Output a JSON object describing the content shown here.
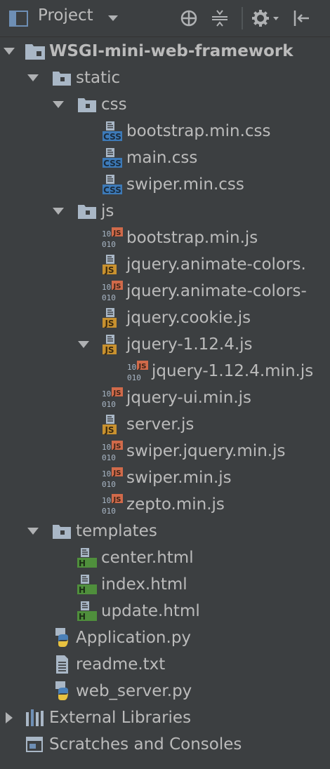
{
  "toolbar": {
    "title": "Project",
    "icons": [
      "project-view-icon",
      "caret-down-icon",
      "locate-icon",
      "collapse-all-icon",
      "gear-icon",
      "hide-icon"
    ]
  },
  "colors": {
    "background": "#3c3f41",
    "text": "#bbbbbb",
    "css_badge": "#3d7ab8",
    "js_badge": "#c8912f",
    "minjs_badge": "#d16a4a",
    "html_badge": "#4f8f3c"
  },
  "tree": {
    "root": "WSGI-mini-web-framework",
    "static": "static",
    "css": "css",
    "css_files": [
      "bootstrap.min.css",
      "main.css",
      "swiper.min.css"
    ],
    "js": "js",
    "js_files": [
      "bootstrap.min.js",
      "jquery.animate-colors.",
      "jquery.animate-colors-",
      "jquery.cookie.js",
      "jquery-1.12.4.js",
      "jquery-1.12.4.min.js",
      "jquery-ui.min.js",
      "server.js",
      "swiper.jquery.min.js",
      "swiper.min.js",
      "zepto.min.js"
    ],
    "templates": "templates",
    "template_files": [
      "center.html",
      "index.html",
      "update.html"
    ],
    "application": "Application.py",
    "readme": "readme.txt",
    "web_server": "web_server.py",
    "external_libraries": "External Libraries",
    "scratches": "Scratches and Consoles"
  }
}
